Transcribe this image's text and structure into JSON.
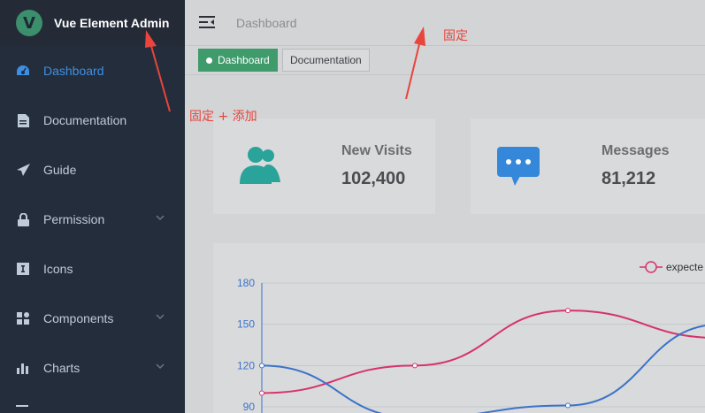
{
  "app": {
    "title": "Vue Element Admin",
    "logo_letter": "V",
    "accent": "#3d8fe6",
    "brand": "#3f9a6c"
  },
  "sidebar": {
    "items": [
      {
        "label": "Dashboard",
        "icon": "dashboard-icon",
        "active": true,
        "submenu": false
      },
      {
        "label": "Documentation",
        "icon": "document-icon",
        "active": false,
        "submenu": false
      },
      {
        "label": "Guide",
        "icon": "paper-plane-icon",
        "active": false,
        "submenu": false
      },
      {
        "label": "Permission",
        "icon": "lock-icon",
        "active": false,
        "submenu": true
      },
      {
        "label": "Icons",
        "icon": "icon-icon",
        "active": false,
        "submenu": false
      },
      {
        "label": "Components",
        "icon": "components-icon",
        "active": false,
        "submenu": true
      },
      {
        "label": "Charts",
        "icon": "chart-icon",
        "active": false,
        "submenu": true
      }
    ]
  },
  "navbar": {
    "breadcrumb": "Dashboard"
  },
  "tags": [
    {
      "label": "Dashboard",
      "active": true
    },
    {
      "label": "Documentation",
      "active": false
    }
  ],
  "panels": [
    {
      "label": "New Visits",
      "value": "102,400",
      "icon": "people-icon"
    },
    {
      "label": "Messages",
      "value": "81,212",
      "icon": "message-icon"
    }
  ],
  "annotations": {
    "fixed": "固定",
    "fixed_add": "固定 + 添加"
  },
  "chart_data": {
    "type": "line",
    "legend": [
      "expecte"
    ],
    "y_ticks": [
      "180",
      "150",
      "120",
      "90"
    ],
    "ylim": [
      90,
      180
    ],
    "grid": true,
    "legend_position": "top-right",
    "series": [
      {
        "name": "expecte",
        "color": "#d6336c",
        "values": [
          100,
          120,
          160,
          140
        ]
      },
      {
        "color": "#3b73c8",
        "values": [
          120,
          82,
          91,
          150
        ]
      }
    ]
  }
}
